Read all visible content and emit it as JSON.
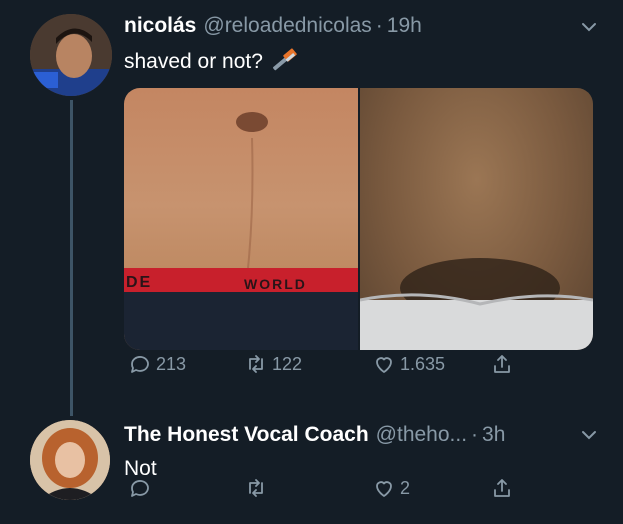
{
  "tweet": {
    "display_name": "nicolás",
    "handle": "@reloadednicolas",
    "separator": "·",
    "time": "19h",
    "text": "shaved or not?",
    "emoji_icon": "razor-icon",
    "media_text_left": "DE",
    "media_text_right": "WORLD",
    "stats": {
      "replies": "213",
      "retweets": "122",
      "likes": "1.635"
    }
  },
  "reply": {
    "display_name": "The Honest Vocal Coach",
    "handle": "@theho...",
    "separator": "·",
    "time": "3h",
    "text": "Not",
    "stats": {
      "likes": "2"
    }
  },
  "colors": {
    "background": "#141d26",
    "secondary_text": "#8899a6",
    "thread_line": "#3d5466",
    "waistband_red": "#c8202c"
  }
}
